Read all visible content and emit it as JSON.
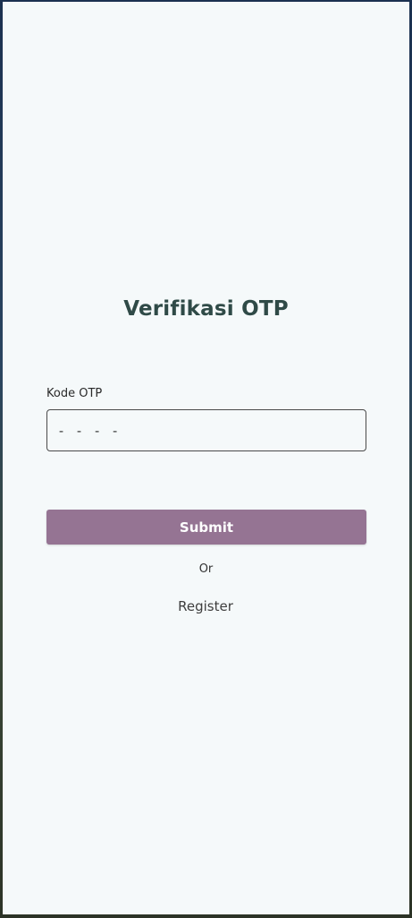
{
  "page": {
    "title": "Verifikasi OTP"
  },
  "form": {
    "otp_label": "Kode OTP",
    "otp_placeholder": "- - - -",
    "otp_value": "",
    "submit_label": "Submit",
    "or_text": "Or",
    "register_label": "Register"
  },
  "colors": {
    "background": "#f5f9fa",
    "title": "#2f4a47",
    "submit_button": "#957493",
    "submit_text": "#ffffff"
  }
}
